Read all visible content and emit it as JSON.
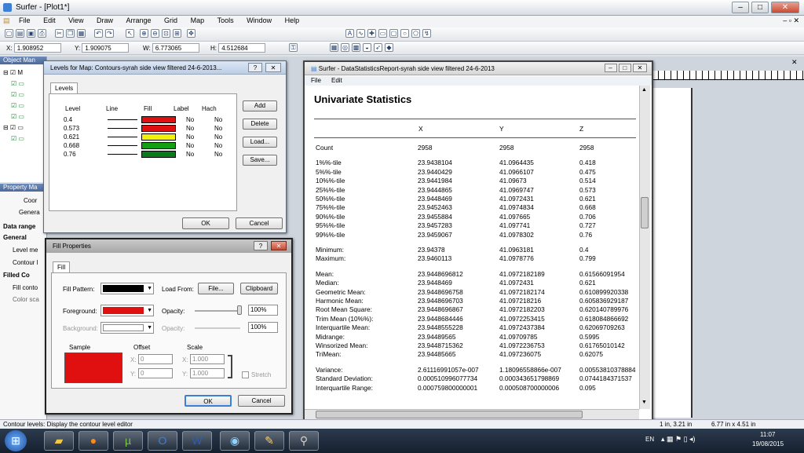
{
  "app": {
    "title": "Surfer - [Plot1*]",
    "menu": [
      "File",
      "Edit",
      "View",
      "Draw",
      "Arrange",
      "Grid",
      "Map",
      "Tools",
      "Window",
      "Help"
    ],
    "coords": {
      "x_label": "X:",
      "x": "1.908952",
      "y_label": "Y:",
      "y": "1.909075",
      "w_label": "W:",
      "w": "6.773065",
      "h_label": "H:",
      "h": "4.512684"
    }
  },
  "left_panel": {
    "object_manager": "Object Man",
    "tree_label": "M",
    "property_manager": "Property Ma",
    "tabs": [
      "Coor",
      "Genera"
    ],
    "rows": [
      "Data range",
      "General",
      "Level me",
      "Contour l",
      "Filled Co",
      "Fill conto",
      "Color sca"
    ]
  },
  "levels_dialog": {
    "title": "Levels for Map: Contours-syrah side view filtered 24-6-2013...",
    "tab": "Levels",
    "headers": {
      "level": "Level",
      "line": "Line",
      "fill": "Fill",
      "label": "Label",
      "hach": "Hach"
    },
    "rows": [
      {
        "level": "0.4",
        "fill": "#e01010",
        "label": "No",
        "hach": "No"
      },
      {
        "level": "0.573",
        "fill": "#e01010",
        "label": "No",
        "hach": "No"
      },
      {
        "level": "0.621",
        "fill": "#f2f20a",
        "label": "No",
        "hach": "No"
      },
      {
        "level": "0.668",
        "fill": "#12a012",
        "label": "No",
        "hach": "No"
      },
      {
        "level": "0.76",
        "fill": "#0b7a1a",
        "label": "No",
        "hach": "No"
      }
    ],
    "buttons": {
      "add": "Add",
      "delete": "Delete",
      "load": "Load...",
      "save": "Save...",
      "ok": "OK",
      "cancel": "Cancel"
    }
  },
  "fill_dialog": {
    "title": "Fill Properties",
    "tab": "Fill",
    "fill_pattern": "Fill Pattern:",
    "load_from": "Load From:",
    "file_btn": "File...",
    "clipboard_btn": "Clipboard",
    "foreground": "Foreground:",
    "background": "Background:",
    "opacity": "Opacity:",
    "opacity_fg": "100%",
    "opacity_bg": "100%",
    "sample": "Sample",
    "offset": "Offset",
    "scale": "Scale",
    "offset_x": "0",
    "offset_y": "0",
    "scale_x": "1.000",
    "scale_y": "1.000",
    "stretch": "Stretch",
    "ok": "OK",
    "cancel": "Cancel",
    "pattern_color": "#000000",
    "foreground_color": "#e01010",
    "background_color": "#ffffff"
  },
  "stats_window": {
    "title": "Surfer - DataStatisticsReport-syrah side view filtered 24-6-2013",
    "menu": [
      "File",
      "Edit"
    ],
    "heading": "Univariate Statistics",
    "columns": [
      "X",
      "Y",
      "Z"
    ],
    "rows": [
      {
        "label": "Count",
        "x": "2958",
        "y": "2958",
        "z": "2958"
      },
      {
        "label": "",
        "x": "",
        "y": "",
        "z": ""
      },
      {
        "label": "1%%-tile",
        "x": "23.9438104",
        "y": "41.0964435",
        "z": "0.418"
      },
      {
        "label": "5%%-tile",
        "x": "23.9440429",
        "y": "41.0966107",
        "z": "0.475"
      },
      {
        "label": "10%%-tile",
        "x": "23.9441984",
        "y": "41.09673",
        "z": "0.514"
      },
      {
        "label": "25%%-tile",
        "x": "23.9444865",
        "y": "41.0969747",
        "z": "0.573"
      },
      {
        "label": "50%%-tile",
        "x": "23.9448469",
        "y": "41.0972431",
        "z": "0.621"
      },
      {
        "label": "75%%-tile",
        "x": "23.9452463",
        "y": "41.0974834",
        "z": "0.668"
      },
      {
        "label": "90%%-tile",
        "x": "23.9455884",
        "y": "41.097665",
        "z": "0.706"
      },
      {
        "label": "95%%-tile",
        "x": "23.9457283",
        "y": "41.097741",
        "z": "0.727"
      },
      {
        "label": "99%%-tile",
        "x": "23.9459067",
        "y": "41.0978302",
        "z": "0.76"
      },
      {
        "label": "",
        "x": "",
        "y": "",
        "z": ""
      },
      {
        "label": "Minimum:",
        "x": "23.94378",
        "y": "41.0963181",
        "z": "0.4"
      },
      {
        "label": "Maximum:",
        "x": "23.9460113",
        "y": "41.0978776",
        "z": "0.799"
      },
      {
        "label": "",
        "x": "",
        "y": "",
        "z": ""
      },
      {
        "label": "Mean:",
        "x": "23.9448696812",
        "y": "41.0972182189",
        "z": "0.61566091954"
      },
      {
        "label": "Median:",
        "x": "23.9448469",
        "y": "41.0972431",
        "z": "0.621"
      },
      {
        "label": "Geometric Mean:",
        "x": "23.9448696758",
        "y": "41.0972182174",
        "z": "0.610899920338"
      },
      {
        "label": "Harmonic Mean:",
        "x": "23.9448696703",
        "y": "41.097218216",
        "z": "0.605836929187"
      },
      {
        "label": "Root Mean Square:",
        "x": "23.9448696867",
        "y": "41.0972182203",
        "z": "0.620140789976"
      },
      {
        "label": "Trim Mean (10%%):",
        "x": "23.9448684446",
        "y": "41.0972253415",
        "z": "0.618084866692"
      },
      {
        "label": "Interquartile Mean:",
        "x": "23.9448555228",
        "y": "41.0972437384",
        "z": "0.62069709263"
      },
      {
        "label": "Midrange:",
        "x": "23.94489565",
        "y": "41.09709785",
        "z": "0.5995"
      },
      {
        "label": "Winsorized Mean:",
        "x": "23.9448715362",
        "y": "41.0972236753",
        "z": "0.61765010142"
      },
      {
        "label": "TriMean:",
        "x": "23.94485665",
        "y": "41.097236075",
        "z": "0.62075"
      },
      {
        "label": "",
        "x": "",
        "y": "",
        "z": ""
      },
      {
        "label": "Variance:",
        "x": "2.61116991057e-007",
        "y": "1.18096558866e-007",
        "z": "0.00553810378884"
      },
      {
        "label": "Standard Deviation:",
        "x": "0.000510996077734",
        "y": "0.000343651798869",
        "z": "0.0744184371537"
      },
      {
        "label": "Interquartile Range:",
        "x": "0.000759800000001",
        "y": "0.000508700000006",
        "z": "0.095"
      }
    ]
  },
  "status": {
    "text": "Contour levels: Display the contour level editor",
    "pos": "1 in, 3.21 in",
    "size": "6.77 in x 4.51 in"
  },
  "taskbar": {
    "lang": "EN",
    "time": "11:07",
    "date": "19/08/2015"
  }
}
